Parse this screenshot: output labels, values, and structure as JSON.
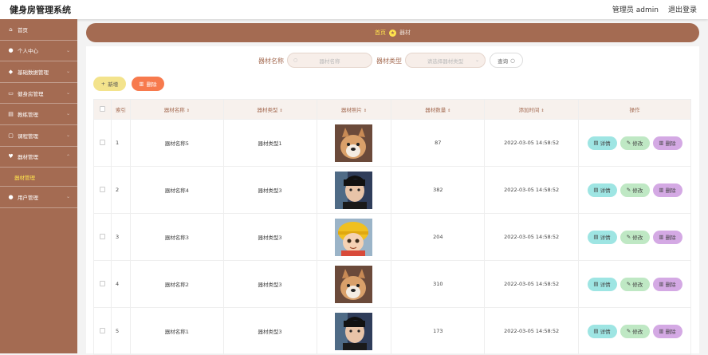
{
  "app": {
    "title": "健身房管理系统",
    "user": "管理员 admin",
    "logout": "退出登录"
  },
  "sidebar": {
    "items": [
      {
        "label": "首页",
        "icon": "home-icon"
      },
      {
        "label": "个人中心",
        "icon": "user-icon"
      },
      {
        "label": "基础数据管理",
        "icon": "database-icon"
      },
      {
        "label": "健身房管理",
        "icon": "building-icon"
      },
      {
        "label": "教练管理",
        "icon": "coach-icon"
      },
      {
        "label": "课程管理",
        "icon": "course-icon"
      },
      {
        "label": "器材管理",
        "icon": "equipment-icon"
      },
      {
        "label": "用户管理",
        "icon": "users-icon"
      }
    ],
    "active_sub": "器材管理"
  },
  "breadcrumb": {
    "home": "首页",
    "current": "器材"
  },
  "search": {
    "name_label": "器材名称",
    "name_placeholder": "器材名称",
    "type_label": "器材类型",
    "type_placeholder": "请选择器材类型",
    "query_label": "查询"
  },
  "toolbar": {
    "add_label": "新增",
    "delete_label": "删除"
  },
  "table": {
    "columns": [
      "索引",
      "器材名称",
      "器材类型",
      "器材照片",
      "器材数量",
      "添加时间",
      "操作"
    ],
    "rows": [
      {
        "index": "1",
        "name": "器材名称5",
        "type": "器材类型1",
        "photo": "dog",
        "count": "87",
        "time": "2022-03-05 14:58:52"
      },
      {
        "index": "2",
        "name": "器材名称4",
        "type": "器材类型3",
        "photo": "person",
        "count": "382",
        "time": "2022-03-05 14:58:52"
      },
      {
        "index": "3",
        "name": "器材名称3",
        "type": "器材类型3",
        "photo": "cartoon",
        "count": "204",
        "time": "2022-03-05 14:58:52"
      },
      {
        "index": "4",
        "name": "器材名称2",
        "type": "器材类型3",
        "photo": "dog",
        "count": "310",
        "time": "2022-03-05 14:58:52"
      },
      {
        "index": "5",
        "name": "器材名称1",
        "type": "器材类型3",
        "photo": "person",
        "count": "173",
        "time": "2022-03-05 14:58:52"
      }
    ],
    "actions": {
      "detail": "详情",
      "edit": "修改",
      "delete": "删除"
    }
  },
  "colors": {
    "brand": "#a46b52",
    "accent": "#ffe34d",
    "add": "#f3e38c",
    "delete": "#f77a4d"
  }
}
